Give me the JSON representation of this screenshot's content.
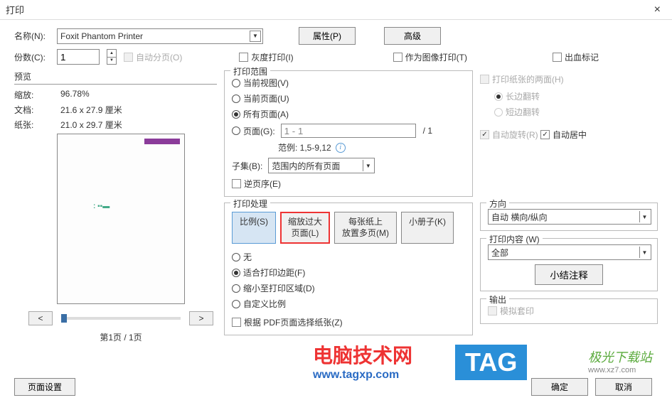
{
  "titlebar": {
    "title": "打印",
    "close": "×"
  },
  "top": {
    "name_label": "名称(N):",
    "printer": "Foxit Phantom Printer",
    "props_btn": "属性(P)",
    "advanced_btn": "高级",
    "copies_label": "份数(C):",
    "copies_value": "1",
    "collate": "自动分页(O)",
    "grayscale": "灰度打印(I)",
    "as_image": "作为图像打印(T)",
    "bleed": "出血标记"
  },
  "preview": {
    "title": "预览",
    "zoom_label": "缩放:",
    "zoom_value": "96.78%",
    "doc_label": "文档:",
    "doc_value": "21.6 x 27.9 厘米",
    "paper_label": "纸张:",
    "paper_value": "21.0 x 29.7 厘米",
    "prev": "<",
    "next": ">",
    "page_info": "第1页 / 1页"
  },
  "range": {
    "legend": "打印范围",
    "current_view": "当前视图(V)",
    "current_page": "当前页面(U)",
    "all_pages": "所有页面(A)",
    "pages": "页面(G):",
    "pages_value": "1 - 1",
    "pages_total": "/ 1",
    "hint": "范例: 1,5-9,12",
    "subset_label": "子集(B):",
    "subset_value": "范围内的所有页面",
    "reverse": "逆页序(E)"
  },
  "paper_opts": {
    "duplex": "打印纸张的两面(H)",
    "long_edge": "长边翻转",
    "short_edge": "短边翻转",
    "auto_rotate": "自动旋转(R)",
    "auto_center": "自动居中"
  },
  "handling": {
    "legend": "打印处理",
    "tab_scale": "比例(S)",
    "tab_shrink": "缩放过大\n页面(L)",
    "tab_multi": "每张纸上\n放置多页(M)",
    "tab_booklet": "小册子(K)",
    "none": "无",
    "fit_margins": "适合打印边距(F)",
    "shrink_area": "缩小至打印区域(D)",
    "custom_ratio": "自定义比例",
    "by_pdf_page": "根据 PDF页面选择纸张(Z)"
  },
  "direction": {
    "legend": "方向",
    "value": "自动 横向/纵向"
  },
  "content": {
    "legend": "打印内容 (W)",
    "value": "全部",
    "summary_btn": "小结注释"
  },
  "output": {
    "legend": "输出",
    "simulate": "模拟套印"
  },
  "bottom": {
    "page_setup": "页面设置",
    "ok": "确定",
    "cancel": "取消"
  },
  "watermarks": {
    "w1": "电脑技术网",
    "w1sub": "www.tagxp.com",
    "w2": "TAG",
    "w3": "极光下载站",
    "w3sub": "www.xz7.com"
  }
}
